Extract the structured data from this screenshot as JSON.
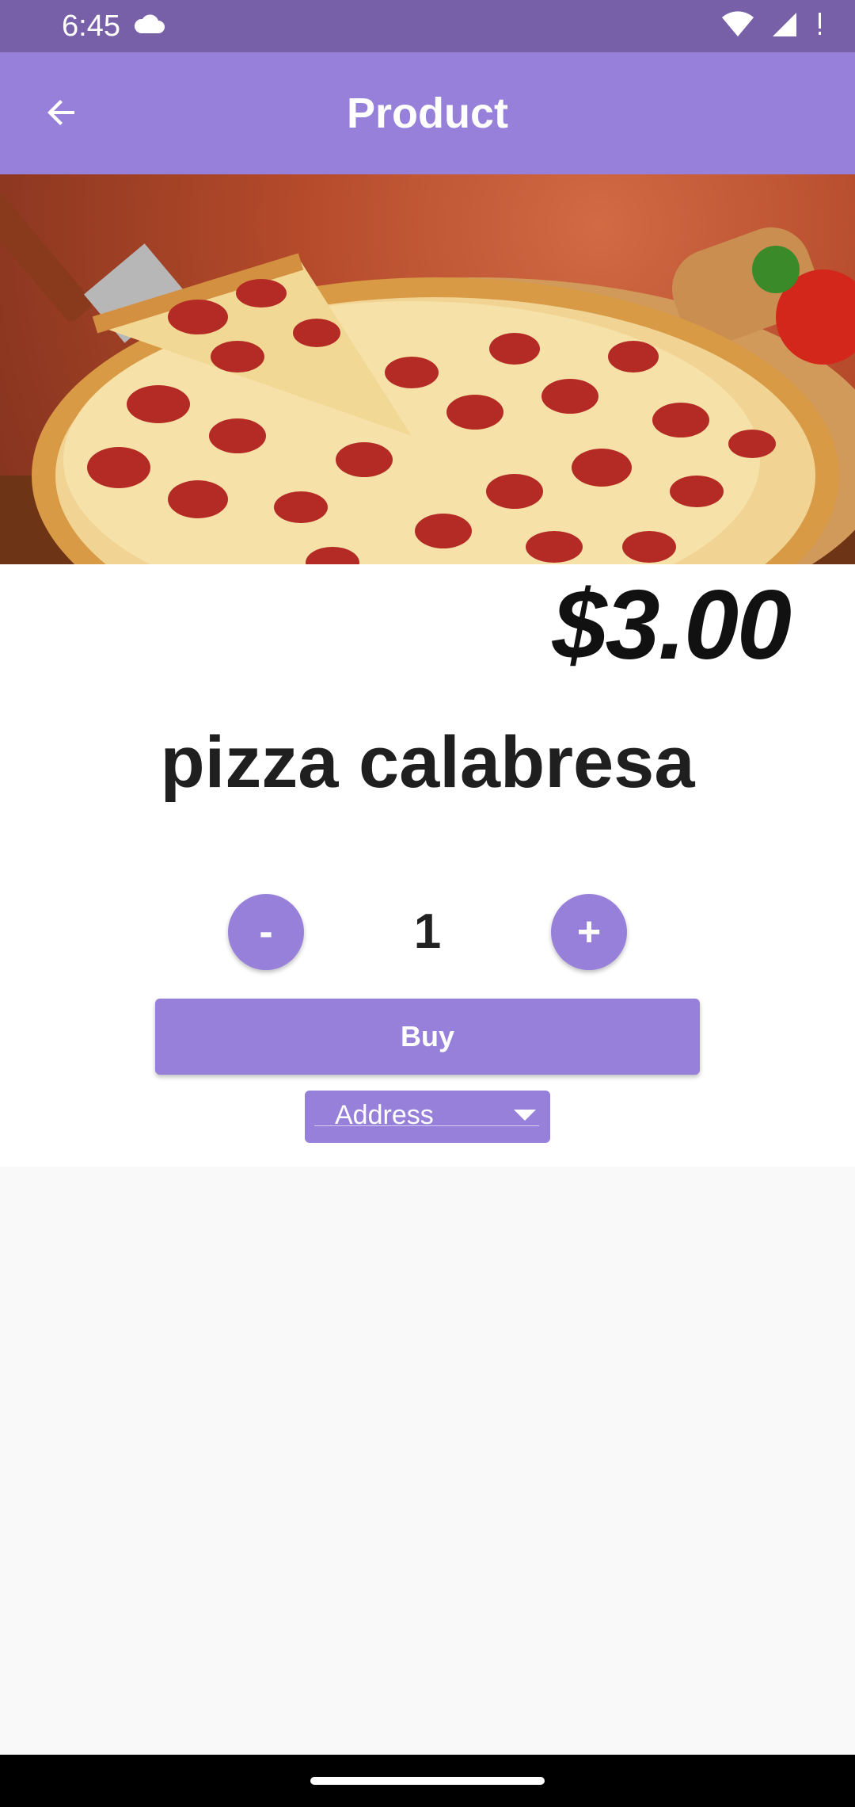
{
  "status_bar": {
    "time": "6:45"
  },
  "app_bar": {
    "title": "Product"
  },
  "product": {
    "price": "$3.00",
    "name": "pizza calabresa",
    "quantity": "1"
  },
  "controls": {
    "minus_label": "-",
    "plus_label": "+",
    "buy_label": "Buy",
    "address_label": "Address"
  },
  "colors": {
    "status_bar": "#7860a8",
    "app_bar": "#9680da",
    "accent": "#9680da",
    "background": "#f9f9f9"
  }
}
